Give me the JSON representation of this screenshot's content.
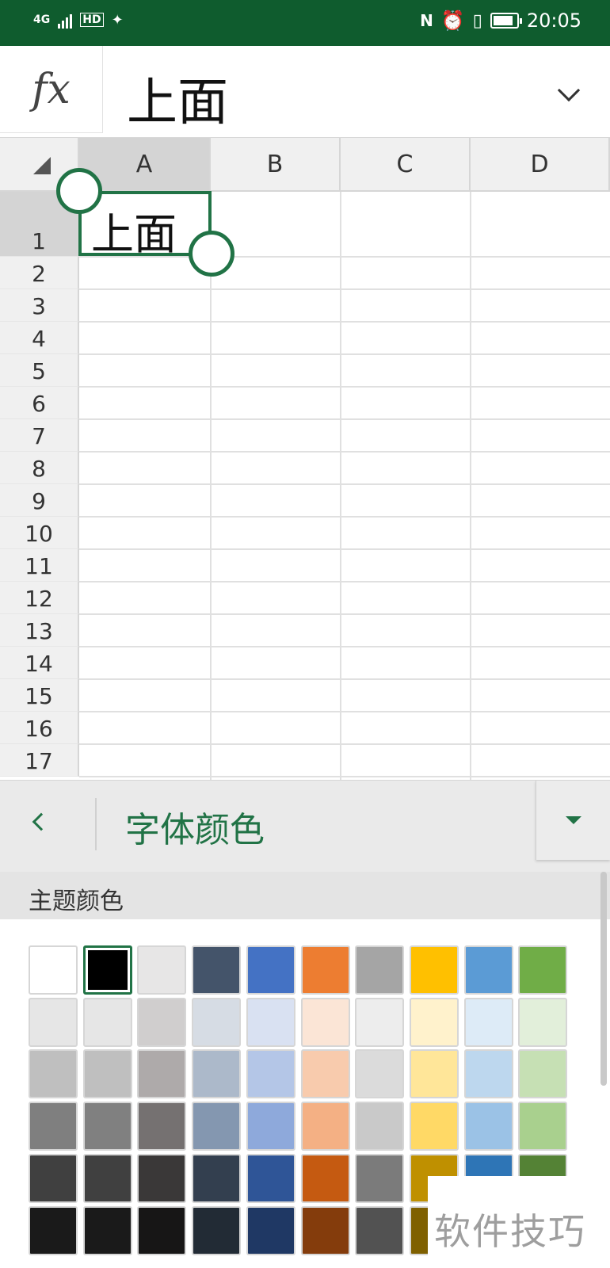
{
  "status_bar": {
    "network": "4G",
    "time": "20:05",
    "battery_level": 0.85
  },
  "formula_bar": {
    "fx_label": "fx",
    "value": "上面"
  },
  "grid": {
    "columns": [
      "A",
      "B",
      "C",
      "D"
    ],
    "selected_column": "A",
    "rows": [
      "1",
      "2",
      "3",
      "4",
      "5",
      "6",
      "7",
      "8",
      "9",
      "10",
      "11",
      "12",
      "13",
      "14",
      "15",
      "16",
      "17"
    ],
    "selected_row": "1",
    "selected_cell_value": "上面"
  },
  "panel": {
    "title": "字体颜色",
    "section_label": "主题颜色"
  },
  "theme_colors": [
    [
      "#FFFFFF",
      "#000000",
      "#E7E6E6",
      "#44546A",
      "#4472C4",
      "#ED7D31",
      "#A5A5A5",
      "#FFC000",
      "#5B9BD5",
      "#70AD47"
    ],
    [
      "#E6E6E6",
      "#E6E6E6",
      "#D0CECE",
      "#D6DCE4",
      "#D9E1F2",
      "#FBE5D6",
      "#EDEDED",
      "#FFF2CC",
      "#DDEBF7",
      "#E2EFDA"
    ],
    [
      "#BFBFBF",
      "#BFBFBF",
      "#AEAAAA",
      "#ACB9CA",
      "#B4C6E7",
      "#F8CBAD",
      "#DBDBDB",
      "#FFE699",
      "#BDD7EE",
      "#C6E0B4"
    ],
    [
      "#7F7F7F",
      "#808080",
      "#757171",
      "#8497B0",
      "#8EA9DB",
      "#F4B084",
      "#C9C9C9",
      "#FFD966",
      "#9BC2E6",
      "#A9D08E"
    ],
    [
      "#404040",
      "#404040",
      "#3A3838",
      "#333F4F",
      "#2F5597",
      "#C55A11",
      "#7B7B7B",
      "#BF9000",
      "#2E75B6",
      "#548235"
    ],
    [
      "#1A1A1A",
      "#1A1A1A",
      "#171616",
      "#222B35",
      "#1F3864",
      "#843C0C",
      "#525252",
      "#7F6000",
      "#1F4E78",
      "#375623"
    ]
  ],
  "selected_swatch": [
    0,
    1
  ],
  "watermark": "软件技巧"
}
